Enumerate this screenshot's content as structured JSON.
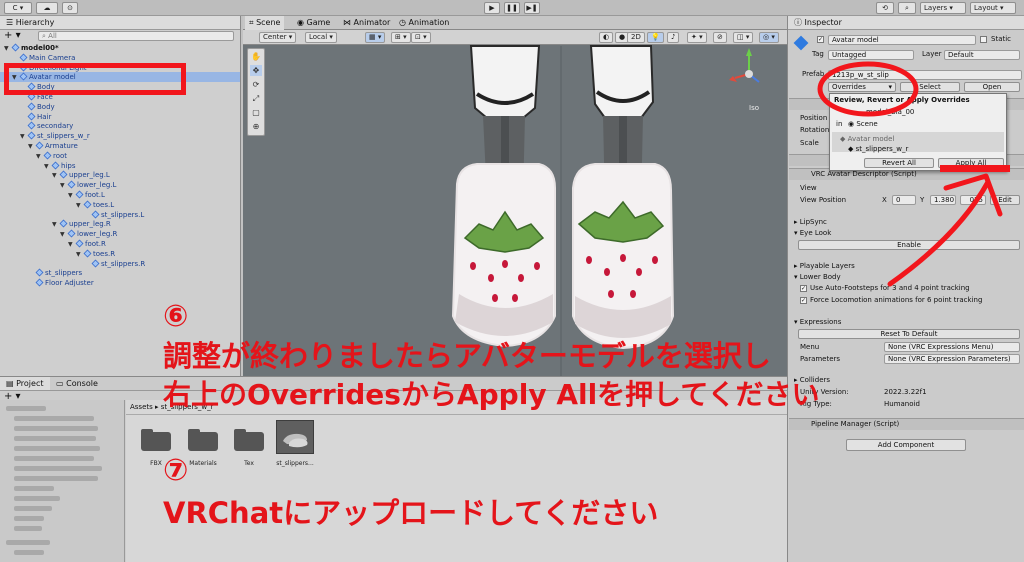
{
  "colors": {
    "annotation_red": "#ee1b22",
    "selection_blue": "#98b6e4",
    "scene_bg": "#6f767a"
  },
  "toolbar": {
    "account": "C",
    "layers": "Layers",
    "layout": "Layout"
  },
  "hierarchy": {
    "tab": "Hierarchy",
    "search_placeholder": "All",
    "add_label": "+",
    "rows": [
      {
        "label": "model00*",
        "indent": 0
      },
      {
        "label": "Main Camera",
        "indent": 1
      },
      {
        "label": "Directional Light",
        "indent": 1
      },
      {
        "label": "Avatar model",
        "indent": 1
      },
      {
        "label": "Body",
        "indent": 2
      },
      {
        "label": "Face",
        "indent": 2
      },
      {
        "label": "Body",
        "indent": 2
      },
      {
        "label": "Hair",
        "indent": 2
      },
      {
        "label": "secondary",
        "indent": 2
      },
      {
        "label": "st_slippers_w_r",
        "indent": 2
      },
      {
        "label": "Armature",
        "indent": 3
      },
      {
        "label": "root",
        "indent": 4
      },
      {
        "label": "hips",
        "indent": 5
      },
      {
        "label": "upper_leg.L",
        "indent": 6
      },
      {
        "label": "lower_leg.L",
        "indent": 7
      },
      {
        "label": "foot.L",
        "indent": 8
      },
      {
        "label": "toes.L",
        "indent": 9
      },
      {
        "label": "st_slippers.L",
        "indent": 10
      },
      {
        "label": "upper_leg.R",
        "indent": 6
      },
      {
        "label": "lower_leg.R",
        "indent": 7
      },
      {
        "label": "foot.R",
        "indent": 8
      },
      {
        "label": "toes.R",
        "indent": 9
      },
      {
        "label": "st_slippers.R",
        "indent": 10
      },
      {
        "label": "st_slippers",
        "indent": 3
      },
      {
        "label": "Floor Adjuster",
        "indent": 3
      }
    ]
  },
  "scene": {
    "tabs": [
      "Scene",
      "Game",
      "Animator",
      "Animation"
    ],
    "pivot": "Center",
    "space": "Local",
    "mode_2d": "2D",
    "gizmo_label": "Iso",
    "tools": [
      "✋",
      "✥",
      "⟳",
      "⤢",
      "▢",
      "⊕"
    ]
  },
  "inspector": {
    "tab": "Inspector",
    "object_name": "Avatar model",
    "static_label": "Static",
    "tag_label": "Tag",
    "tag_value": "Untagged",
    "layer_label": "Layer",
    "layer_value": "Default",
    "prefab_label": "Prefab",
    "prefab_value": "1213p_w_st_slip",
    "overrides": "Overrides",
    "select": "Select",
    "open": "Open",
    "transform_labels": [
      "Position",
      "Rotation",
      "Scale"
    ],
    "descriptor_title": "VRC Avatar Descriptor (Script)",
    "view": "View",
    "view_position": "View Position",
    "x_label": "X",
    "x_value": "0",
    "y_label": "Y",
    "y_value": "1.380",
    "z_value": "075",
    "edit": "Edit",
    "lipsync": "LipSync",
    "eyelook": "Eye Look",
    "enable": "Enable",
    "playable_layers": "Playable Layers",
    "lower_body": "Lower Body",
    "auto_footsteps": "Use Auto-Footsteps for 3 and 4 point tracking",
    "force_locomotion": "Force Locomotion animations for 6 point tracking",
    "expressions": "Expressions",
    "reset_default": "Reset To Default",
    "menu_label": "Menu",
    "menu_value": "None (VRC Expressions Menu)",
    "params_label": "Parameters",
    "params_value": "None (VRC Expression Parameters)",
    "colliders": "Colliders",
    "unity_version_label": "Unity Version:",
    "unity_version": "2022.3.22f1",
    "rig_type_label": "Rig Type:",
    "rig_type": "Humanoid",
    "pipeline": "Pipeline Manager (Script)",
    "add_component": "Add Component"
  },
  "popup": {
    "title": "Review, Revert or Apply Overrides",
    "item_prefab": "model_bla_00",
    "in_label": "in",
    "scene_label": "Scene",
    "avatar_model": "Avatar model",
    "slippers": "st_slippers_w_r",
    "revert_all": "Revert All",
    "apply_all": "Apply All"
  },
  "project": {
    "tabs": [
      "Project",
      "Console"
    ],
    "breadcrumb_root": "Assets",
    "breadcrumb_current": "st_slippers_w_r",
    "items": [
      "FBX",
      "Materials",
      "Tex",
      "st_slippers..."
    ]
  },
  "annotations": {
    "step6_number": "⑥",
    "step6_line1": "調整が終わりましたらアバターモデルを選択し",
    "step6_line2": "右上のOverridesからApply Allを押してください",
    "step7_number": "⑦",
    "step7_line1": "VRChatにアップロードしてください"
  }
}
